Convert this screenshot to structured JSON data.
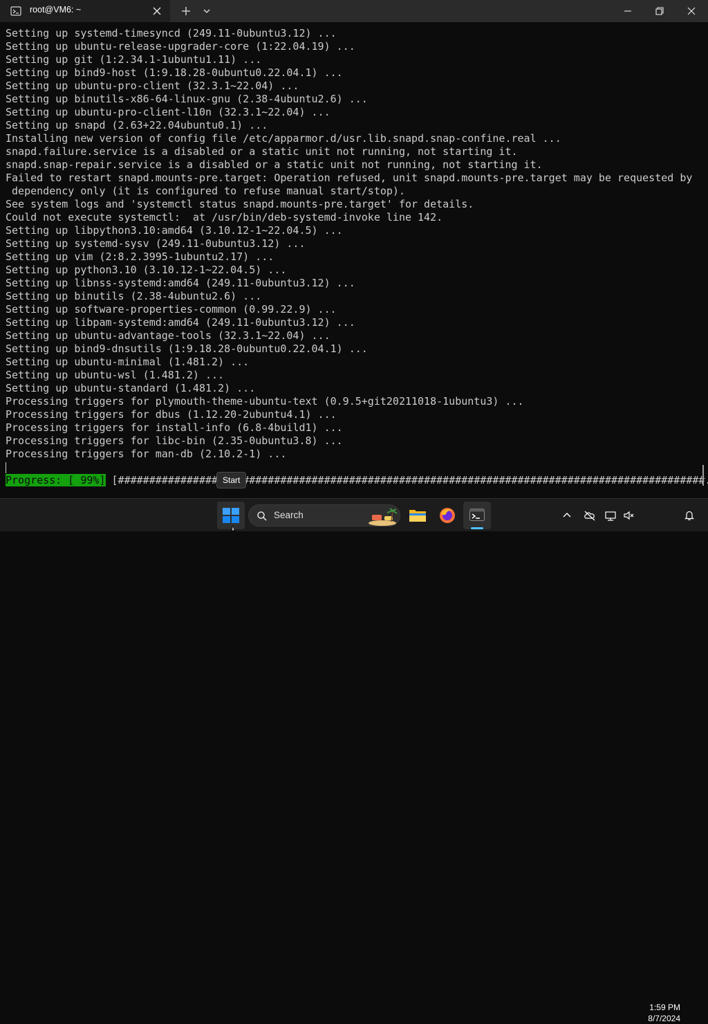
{
  "window": {
    "tab_title": "root@VM6: ~",
    "icons": {
      "tab": "terminal-icon",
      "close_tab": "close-icon",
      "new_tab": "plus-icon",
      "dropdown": "chevron-down-icon",
      "minimize": "minimize-icon",
      "maximize": "maximize-icon",
      "close_window": "close-icon"
    }
  },
  "terminal": {
    "lines": [
      "Setting up systemd-timesyncd (249.11-0ubuntu3.12) ...",
      "Setting up ubuntu-release-upgrader-core (1:22.04.19) ...",
      "Setting up git (1:2.34.1-1ubuntu1.11) ...",
      "Setting up bind9-host (1:9.18.28-0ubuntu0.22.04.1) ...",
      "Setting up ubuntu-pro-client (32.3.1~22.04) ...",
      "Setting up binutils-x86-64-linux-gnu (2.38-4ubuntu2.6) ...",
      "Setting up ubuntu-pro-client-l10n (32.3.1~22.04) ...",
      "Setting up snapd (2.63+22.04ubuntu0.1) ...",
      "Installing new version of config file /etc/apparmor.d/usr.lib.snapd.snap-confine.real ...",
      "snapd.failure.service is a disabled or a static unit not running, not starting it.",
      "snapd.snap-repair.service is a disabled or a static unit not running, not starting it.",
      "Failed to restart snapd.mounts-pre.target: Operation refused, unit snapd.mounts-pre.target may be requested by",
      " dependency only (it is configured to refuse manual start/stop).",
      "See system logs and 'systemctl status snapd.mounts-pre.target' for details.",
      "Could not execute systemctl:  at /usr/bin/deb-systemd-invoke line 142.",
      "Setting up libpython3.10:amd64 (3.10.12-1~22.04.5) ...",
      "Setting up systemd-sysv (249.11-0ubuntu3.12) ...",
      "Setting up vim (2:8.2.3995-1ubuntu2.17) ...",
      "Setting up python3.10 (3.10.12-1~22.04.5) ...",
      "Setting up libnss-systemd:amd64 (249.11-0ubuntu3.12) ...",
      "Setting up binutils (2.38-4ubuntu2.6) ...",
      "Setting up software-properties-common (0.99.22.9) ...",
      "Setting up libpam-systemd:amd64 (249.11-0ubuntu3.12) ...",
      "Setting up ubuntu-advantage-tools (32.3.1~22.04) ...",
      "Setting up bind9-dnsutils (1:9.18.28-0ubuntu0.22.04.1) ...",
      "Setting up ubuntu-minimal (1.481.2) ...",
      "Setting up ubuntu-wsl (1.481.2) ...",
      "Setting up ubuntu-standard (1.481.2) ...",
      "Processing triggers for plymouth-theme-ubuntu-text (0.9.5+git20211018-1ubuntu3) ...",
      "Processing triggers for dbus (1.12.20-2ubuntu4.1) ...",
      "Processing triggers for install-info (6.8-4build1) ...",
      "Processing triggers for libc-bin (2.35-0ubuntu3.8) ...",
      "Processing triggers for man-db (2.10.2-1) ..."
    ],
    "progress_label": "Progress: [ 99%]",
    "progress_bar": " [##############################################################################################.]",
    "progress_value": 0.99,
    "colors": {
      "background": "#0c0c0c",
      "text": "#cccccc",
      "progress_highlight": "#13a10e"
    }
  },
  "tooltip": {
    "text": "Start"
  },
  "taskbar": {
    "search_placeholder": "Search",
    "icons": {
      "start": "windows-start-icon",
      "search": "search-icon",
      "explorer": "folder-icon",
      "browser": "firefox-icon",
      "terminal": "terminal-app-icon",
      "tray_chevron": "chevron-up-icon",
      "onedrive": "cloud-off-icon",
      "network": "network-icon",
      "volume": "volume-muted-icon",
      "notifications": "bell-icon"
    },
    "clock": {
      "time": "1:59 PM",
      "date": "8/7/2024"
    },
    "colors": {
      "accent": "#4cc2ff"
    }
  }
}
